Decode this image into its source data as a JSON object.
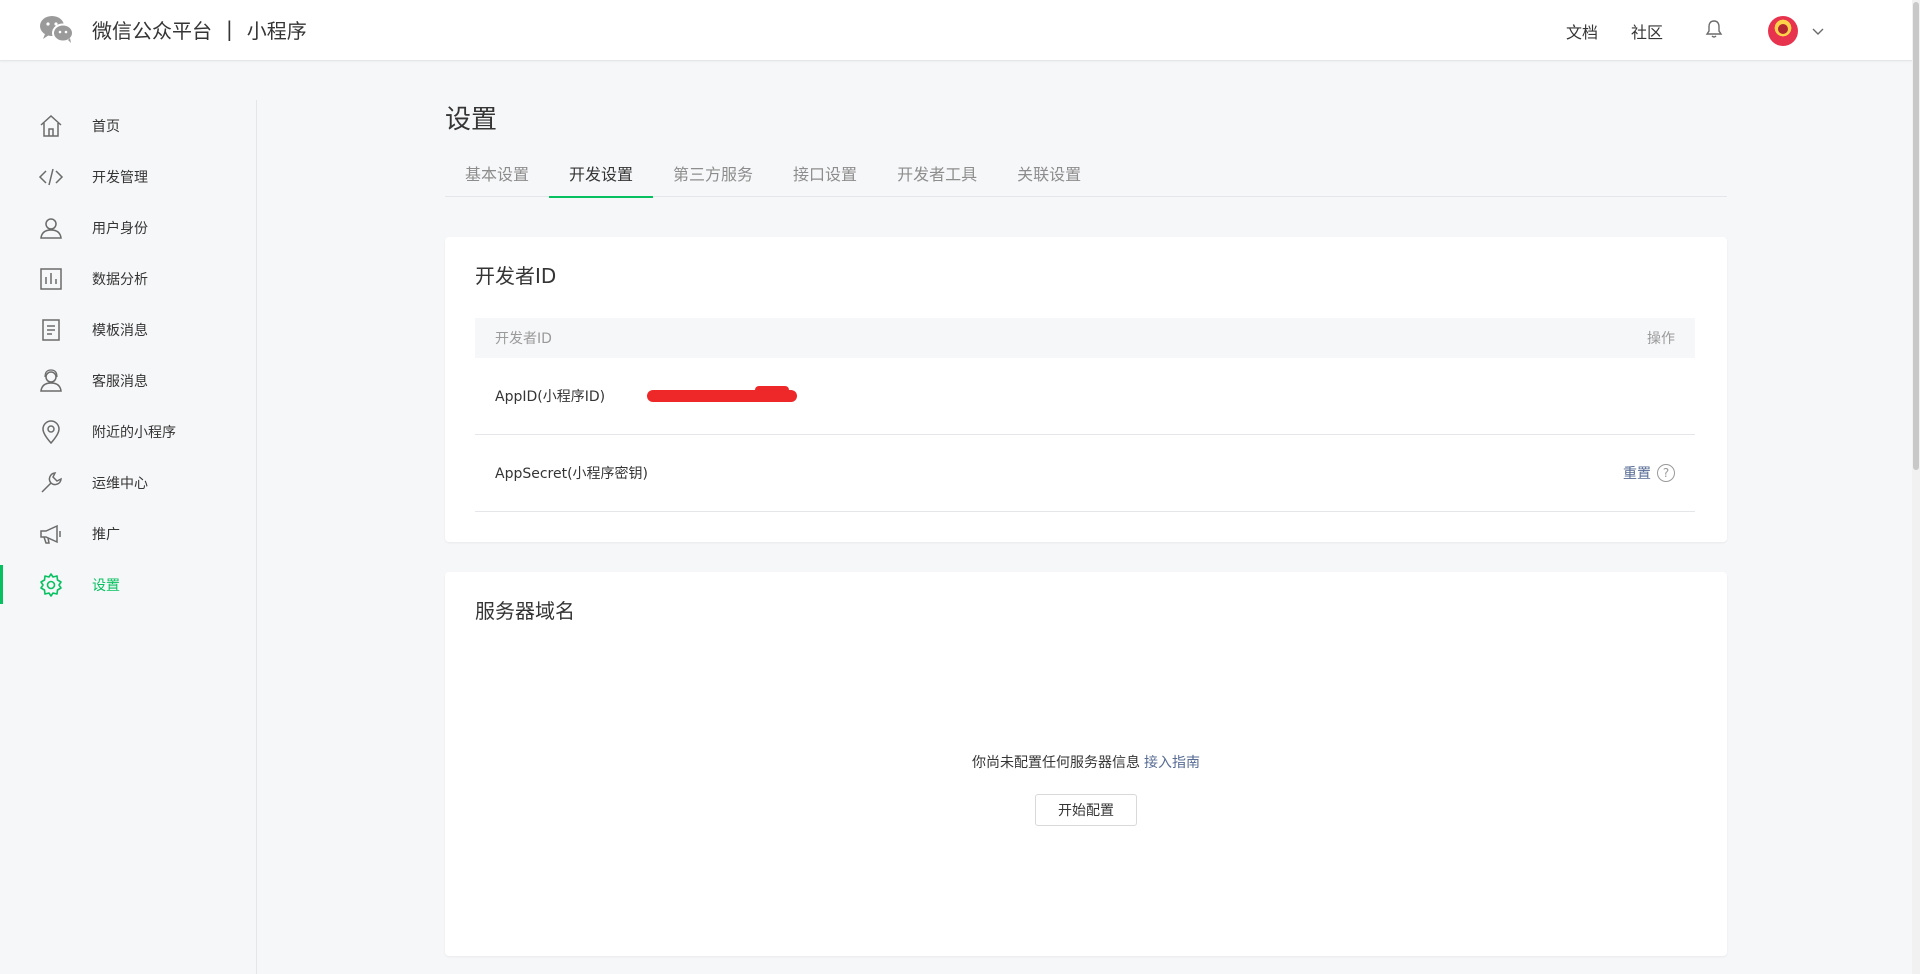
{
  "header": {
    "brand_main": "微信公众平台",
    "brand_sep": "|",
    "brand_sub": "小程序",
    "links": [
      "文档",
      "社区"
    ]
  },
  "sidebar": {
    "items": [
      {
        "label": "首页",
        "icon": "home-icon"
      },
      {
        "label": "开发管理",
        "icon": "code-icon"
      },
      {
        "label": "用户身份",
        "icon": "user-icon"
      },
      {
        "label": "数据分析",
        "icon": "chart-icon"
      },
      {
        "label": "模板消息",
        "icon": "document-icon"
      },
      {
        "label": "客服消息",
        "icon": "support-icon"
      },
      {
        "label": "附近的小程序",
        "icon": "location-icon"
      },
      {
        "label": "运维中心",
        "icon": "wrench-icon"
      },
      {
        "label": "推广",
        "icon": "megaphone-icon"
      },
      {
        "label": "设置",
        "icon": "settings-icon"
      }
    ],
    "active_index": 9
  },
  "main": {
    "title": "设置",
    "tabs": [
      "基本设置",
      "开发设置",
      "第三方服务",
      "接口设置",
      "开发者工具",
      "关联设置"
    ],
    "active_tab": 1,
    "developer": {
      "title": "开发者ID",
      "header_col1": "开发者ID",
      "header_col2": "操作",
      "appid_label": "AppID(小程序ID)",
      "appsecret_label": "AppSecret(小程序密钥)",
      "reset_label": "重置",
      "help_symbol": "?"
    },
    "server": {
      "title": "服务器域名",
      "empty_text": "你尚未配置任何服务器信息",
      "guide_link": "接入指南",
      "start_button": "开始配置"
    }
  },
  "colors": {
    "accent": "#07c160",
    "link": "#576b95",
    "redaction": "#ee2828"
  }
}
